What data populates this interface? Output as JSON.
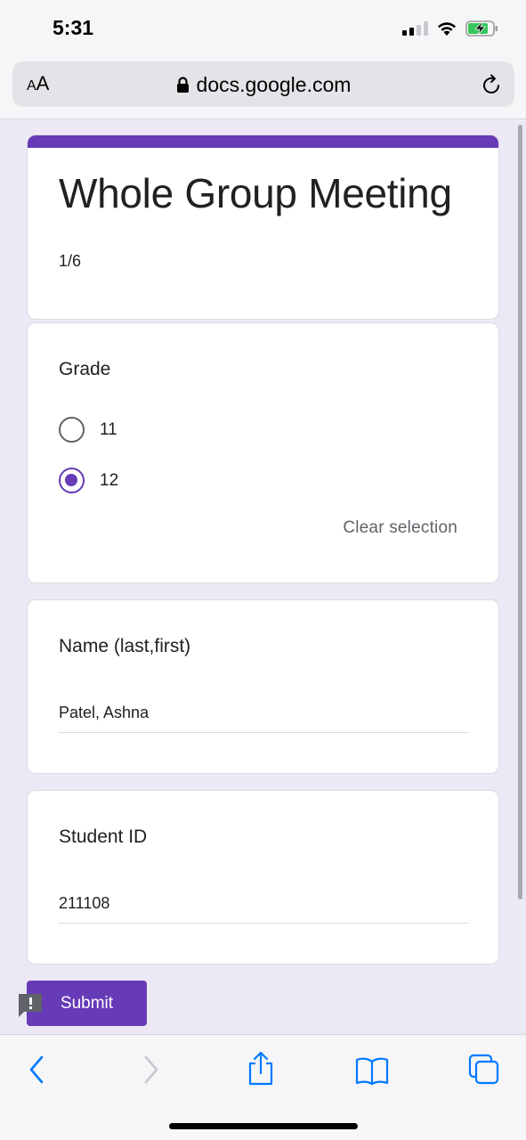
{
  "status_bar": {
    "time": "5:31",
    "icons": [
      "signal-icon",
      "wifi-icon",
      "battery-charging-icon"
    ]
  },
  "browser": {
    "text_size_label": "AA",
    "url": "docs.google.com",
    "lock_icon": "lock-icon",
    "reload_icon": "reload-icon"
  },
  "form": {
    "accent_color": "#673ab7",
    "title": "Whole Group Meeting",
    "page_indicator": "1/6",
    "questions": [
      {
        "label": "Grade",
        "type": "radio",
        "options": [
          {
            "label": "11",
            "selected": false
          },
          {
            "label": "12",
            "selected": true
          }
        ],
        "clear_label": "Clear selection"
      },
      {
        "label": "Name (last,first)",
        "type": "text",
        "value": "Patel, Ashna"
      },
      {
        "label": "Student ID",
        "type": "text",
        "value": "211108"
      }
    ],
    "submit_label": "Submit"
  },
  "toolbar": {
    "items": [
      "back-icon",
      "forward-icon",
      "share-icon",
      "bookmarks-icon",
      "tabs-icon"
    ],
    "accent_color": "#007aff"
  }
}
